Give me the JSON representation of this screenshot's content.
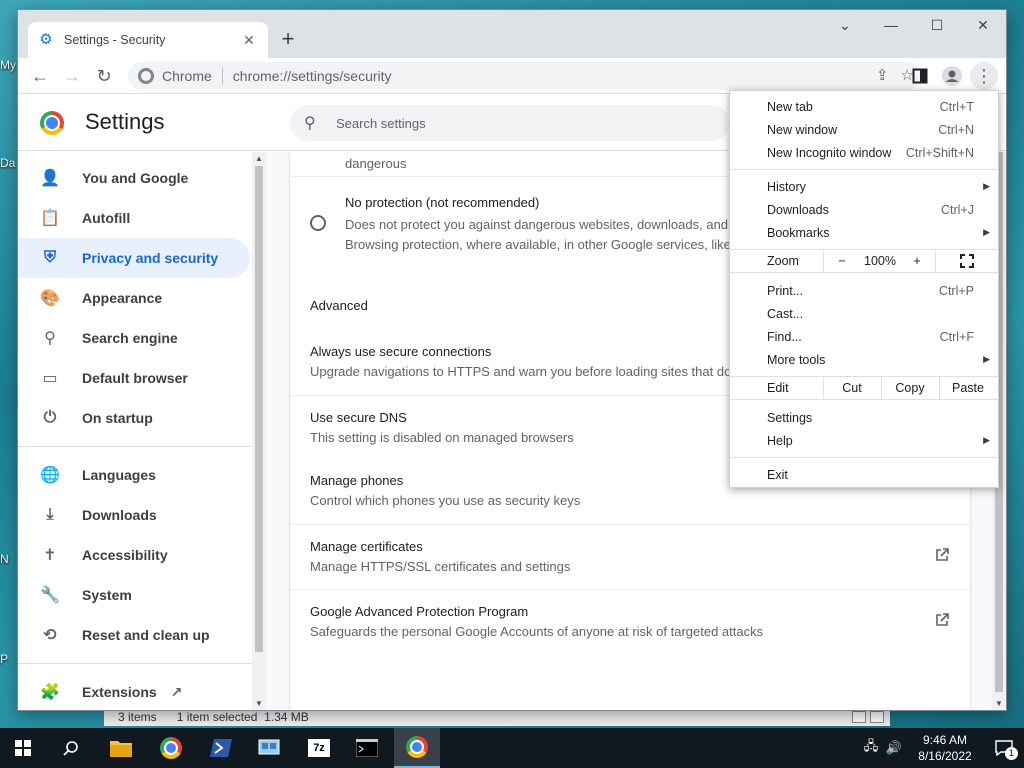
{
  "desktop": {
    "icon_labels": [
      "My",
      "Da",
      "N",
      "P"
    ]
  },
  "explorer_status": {
    "items": "3 items",
    "selected": "1 item selected",
    "size": "1.34 MB"
  },
  "window": {
    "tab_title": "Settings - Security",
    "new_tab_glyph": "+",
    "controls": {
      "dropdown": "⌄",
      "minimize": "—",
      "maximize": "☐",
      "close": "✕"
    }
  },
  "toolbar": {
    "back": "←",
    "forward": "→",
    "reload": "↻",
    "omni_chip": "Chrome",
    "url": "chrome://settings/security"
  },
  "settings": {
    "title": "Settings",
    "search_placeholder": "Search settings",
    "nav": [
      {
        "label": "You and Google",
        "icon": "person-icon"
      },
      {
        "label": "Autofill",
        "icon": "clipboard-icon"
      },
      {
        "label": "Privacy and security",
        "icon": "shield-icon",
        "active": true
      },
      {
        "label": "Appearance",
        "icon": "palette-icon"
      },
      {
        "label": "Search engine",
        "icon": "search-icon"
      },
      {
        "label": "Default browser",
        "icon": "browser-icon"
      },
      {
        "label": "On startup",
        "icon": "power-icon"
      },
      {
        "label": "Languages",
        "icon": "globe-icon"
      },
      {
        "label": "Downloads",
        "icon": "download-icon"
      },
      {
        "label": "Accessibility",
        "icon": "accessibility-icon"
      },
      {
        "label": "System",
        "icon": "wrench-icon"
      },
      {
        "label": "Reset and clean up",
        "icon": "history-icon"
      },
      {
        "label": "Extensions",
        "icon": "puzzle-icon"
      }
    ],
    "content": {
      "cut_text": "dangerous",
      "no_protection_title": "No protection (not recommended)",
      "no_protection_desc_1": "Does not protect you against dangerous websites, downloads, and",
      "no_protection_desc_2": "Browsing protection, where available, in other Google services, like",
      "advanced_label": "Advanced",
      "rows": [
        {
          "title": "Always use secure connections",
          "sub": "Upgrade navigations to HTTPS and warn you before loading sites that do"
        },
        {
          "title": "Use secure DNS",
          "sub": "This setting is disabled on managed browsers"
        },
        {
          "title": "Manage phones",
          "sub": "Control which phones you use as security keys"
        },
        {
          "title": "Manage certificates",
          "sub": "Manage HTTPS/SSL certificates and settings"
        },
        {
          "title": "Google Advanced Protection Program",
          "sub": "Safeguards the personal Google Accounts of anyone at risk of targeted attacks"
        }
      ]
    }
  },
  "menu": {
    "new_tab": "New tab",
    "new_tab_sc": "Ctrl+T",
    "new_window": "New window",
    "new_window_sc": "Ctrl+N",
    "new_incognito": "New Incognito window",
    "new_incognito_sc": "Ctrl+Shift+N",
    "history": "History",
    "downloads": "Downloads",
    "downloads_sc": "Ctrl+J",
    "bookmarks": "Bookmarks",
    "zoom": "Zoom",
    "zoom_minus": "−",
    "zoom_level": "100%",
    "zoom_plus": "+",
    "print": "Print...",
    "print_sc": "Ctrl+P",
    "cast": "Cast...",
    "find": "Find...",
    "find_sc": "Ctrl+F",
    "more_tools": "More tools",
    "edit": "Edit",
    "cut": "Cut",
    "copy": "Copy",
    "paste": "Paste",
    "settings": "Settings",
    "help": "Help",
    "exit": "Exit"
  },
  "taskbar": {
    "time": "9:46 AM",
    "date": "8/16/2022",
    "notifications": "1",
    "apps": [
      "file-explorer-icon",
      "chrome-icon",
      "powershell-icon",
      "network-icon",
      "7zip-icon",
      "terminal-icon",
      "chrome-icon"
    ],
    "app_7zip_label": "7z"
  }
}
